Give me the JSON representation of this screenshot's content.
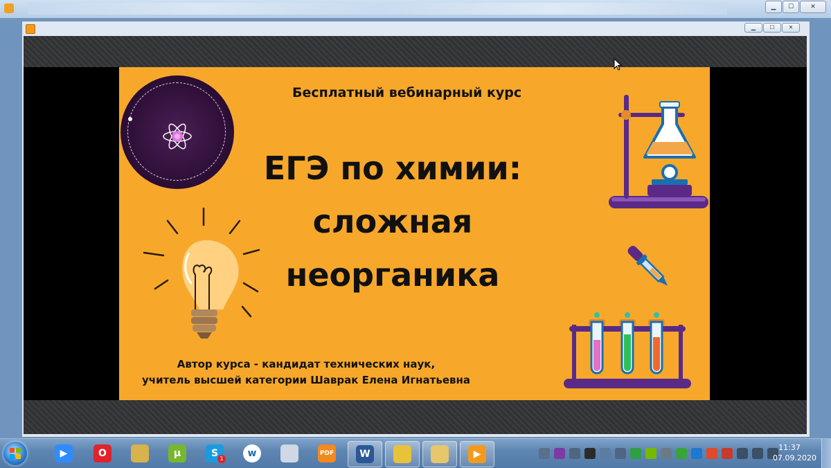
{
  "outer_window": {
    "controls": {
      "minimize": "▁",
      "maximize": "☐",
      "close": "✕"
    }
  },
  "player_window": {
    "controls": {
      "minimize": "▁",
      "maximize": "☐",
      "close": "✕"
    }
  },
  "slide": {
    "subtitle": "Бесплатный вебинарный курс",
    "title_lines": [
      "ЕГЭ по химии:",
      "сложная",
      "неорганика"
    ],
    "author_lines": [
      "Автор курса - кандидат технических наук,",
      "учитель высшей категории Шаврак Елена Игнатьевна"
    ],
    "colors": {
      "background": "#f7a82b",
      "accent_purple": "#5b2a86"
    }
  },
  "taskbar": {
    "apps": [
      {
        "name": "zoom-icon",
        "color": "#2d8cff",
        "glyph": "▶"
      },
      {
        "name": "opera-icon",
        "color": "#e0242b",
        "glyph": "O"
      },
      {
        "name": "folders-icon",
        "color": "#d8b24b",
        "glyph": ""
      },
      {
        "name": "utorrent-icon",
        "color": "#77b72e",
        "glyph": "µ"
      },
      {
        "name": "skype-icon",
        "color": "#1a9be0",
        "glyph": "S",
        "badge": "1"
      },
      {
        "name": "wrike-icon",
        "color": "#ffffff",
        "glyph": "w"
      },
      {
        "name": "paint-icon",
        "color": "#d0d8e4",
        "glyph": ""
      },
      {
        "name": "pdf-icon",
        "color": "#f28a1e",
        "glyph": "PDF"
      },
      {
        "name": "word-icon",
        "color": "#2b5797",
        "glyph": "W"
      },
      {
        "name": "chrome-icon",
        "color": "#e8c33a",
        "glyph": ""
      },
      {
        "name": "explorer-icon",
        "color": "#e8c66c",
        "glyph": ""
      },
      {
        "name": "media-player-icon",
        "color": "#f39a1d",
        "glyph": "▶"
      }
    ],
    "tray_icons": [
      {
        "name": "tray-pen-icon",
        "color": "#5a6f8a"
      },
      {
        "name": "tray-onenote-icon",
        "color": "#7b3aa6"
      },
      {
        "name": "tray-tool-icon",
        "color": "#4f6680"
      },
      {
        "name": "tray-dc-icon",
        "color": "#2b2b2b"
      },
      {
        "name": "tray-chevron-icon",
        "color": "#5d7da0"
      },
      {
        "name": "tray-usb-icon",
        "color": "#4f6680"
      },
      {
        "name": "tray-shield-icon",
        "color": "#2ea043"
      },
      {
        "name": "tray-nvidia-icon",
        "color": "#76b900"
      },
      {
        "name": "tray-mouse-icon",
        "color": "#6c7a88"
      },
      {
        "name": "tray-green-icon",
        "color": "#37a33a"
      },
      {
        "name": "tray-dropbox-icon",
        "color": "#1f78d1"
      },
      {
        "name": "tray-sync-icon",
        "color": "#e04a2a"
      },
      {
        "name": "tray-flag-icon",
        "color": "#c93a2c"
      },
      {
        "name": "tray-network-icon",
        "color": "#3b4f66"
      },
      {
        "name": "tray-signal-icon",
        "color": "#3b4f66"
      },
      {
        "name": "tray-volume-icon",
        "color": "#3b4f66"
      }
    ],
    "clock": {
      "time": "11:37",
      "date": "07.09.2020"
    }
  }
}
